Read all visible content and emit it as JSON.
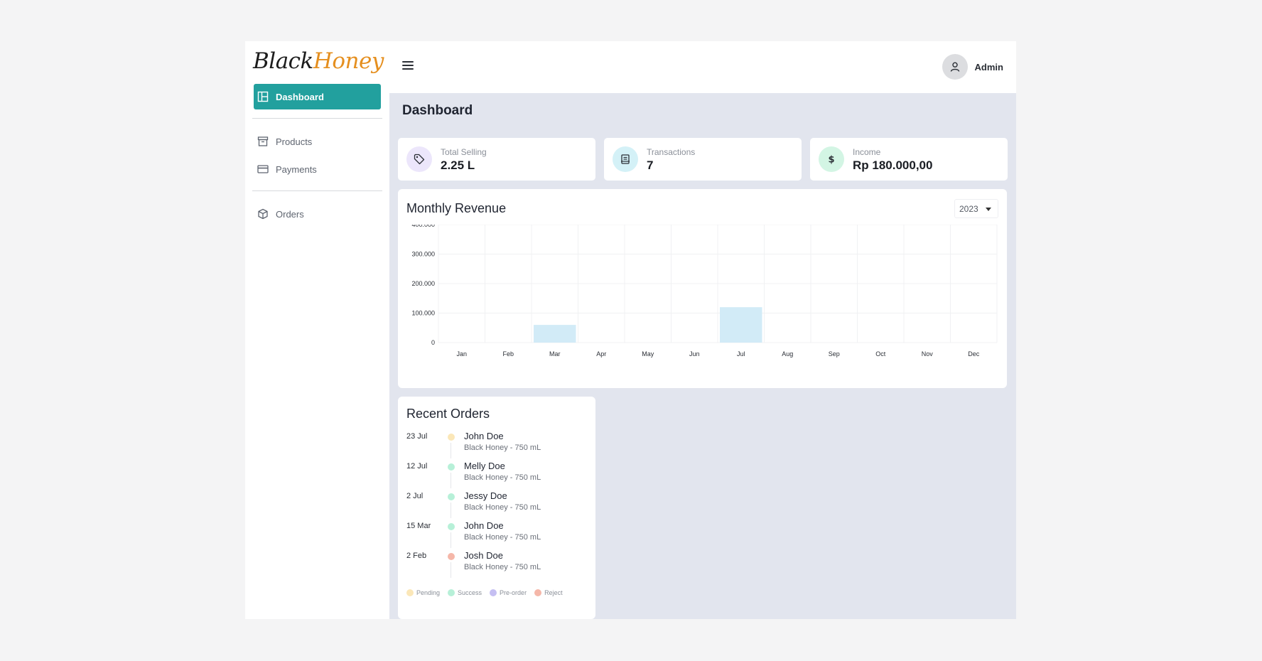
{
  "brand": {
    "part1": "Black",
    "part2": "Honey"
  },
  "sidebar": {
    "items": [
      {
        "label": "Dashboard",
        "icon": "layout-icon"
      },
      {
        "label": "Products",
        "icon": "archive-icon"
      },
      {
        "label": "Payments",
        "icon": "credit-card-icon"
      },
      {
        "label": "Orders",
        "icon": "box-icon"
      }
    ]
  },
  "header": {
    "user_name": "Admin"
  },
  "page": {
    "title": "Dashboard"
  },
  "stats": [
    {
      "label": "Total Selling",
      "value": "2.25 L",
      "icon": "tag-icon",
      "color": "#ece6fb"
    },
    {
      "label": "Transactions",
      "value": "7",
      "icon": "receipt-icon",
      "color": "#d4f1f7"
    },
    {
      "label": "Income",
      "value": "Rp 180.000,00",
      "icon": "dollar-icon",
      "color": "#d3f5e4"
    }
  ],
  "revenue": {
    "title": "Monthly Revenue",
    "year": "2023"
  },
  "chart_data": {
    "type": "bar",
    "categories": [
      "Jan",
      "Feb",
      "Mar",
      "Apr",
      "May",
      "Jun",
      "Jul",
      "Aug",
      "Sep",
      "Oct",
      "Nov",
      "Dec"
    ],
    "values": [
      0,
      0,
      60000,
      0,
      0,
      0,
      120000,
      0,
      0,
      0,
      0,
      0
    ],
    "ylim": [
      0,
      400000
    ],
    "yticks": [
      "0",
      "100.000",
      "200.000",
      "300.000",
      "400.000"
    ],
    "grid": true,
    "bar_color": "#d2ebf7"
  },
  "recent_orders": {
    "title": "Recent Orders",
    "items": [
      {
        "date": "23 Jul",
        "name": "John Doe",
        "product": "Black Honey - 750 mL",
        "color": "#fbe7b8"
      },
      {
        "date": "12 Jul",
        "name": "Melly Doe",
        "product": "Black Honey - 750 mL",
        "color": "#b7f0d8"
      },
      {
        "date": "2 Jul",
        "name": "Jessy Doe",
        "product": "Black Honey - 750 mL",
        "color": "#b7f0d8"
      },
      {
        "date": "15 Mar",
        "name": "John Doe",
        "product": "Black Honey - 750 mL",
        "color": "#b7f0d8"
      },
      {
        "date": "2 Feb",
        "name": "Josh Doe",
        "product": "Black Honey - 750 mL",
        "color": "#f5b7a9"
      }
    ],
    "legend": [
      {
        "label": "Pending",
        "color": "#fbe7b8"
      },
      {
        "label": "Success",
        "color": "#b7f0d8"
      },
      {
        "label": "Pre-order",
        "color": "#c5bff2"
      },
      {
        "label": "Reject",
        "color": "#f5b7a9"
      }
    ]
  }
}
